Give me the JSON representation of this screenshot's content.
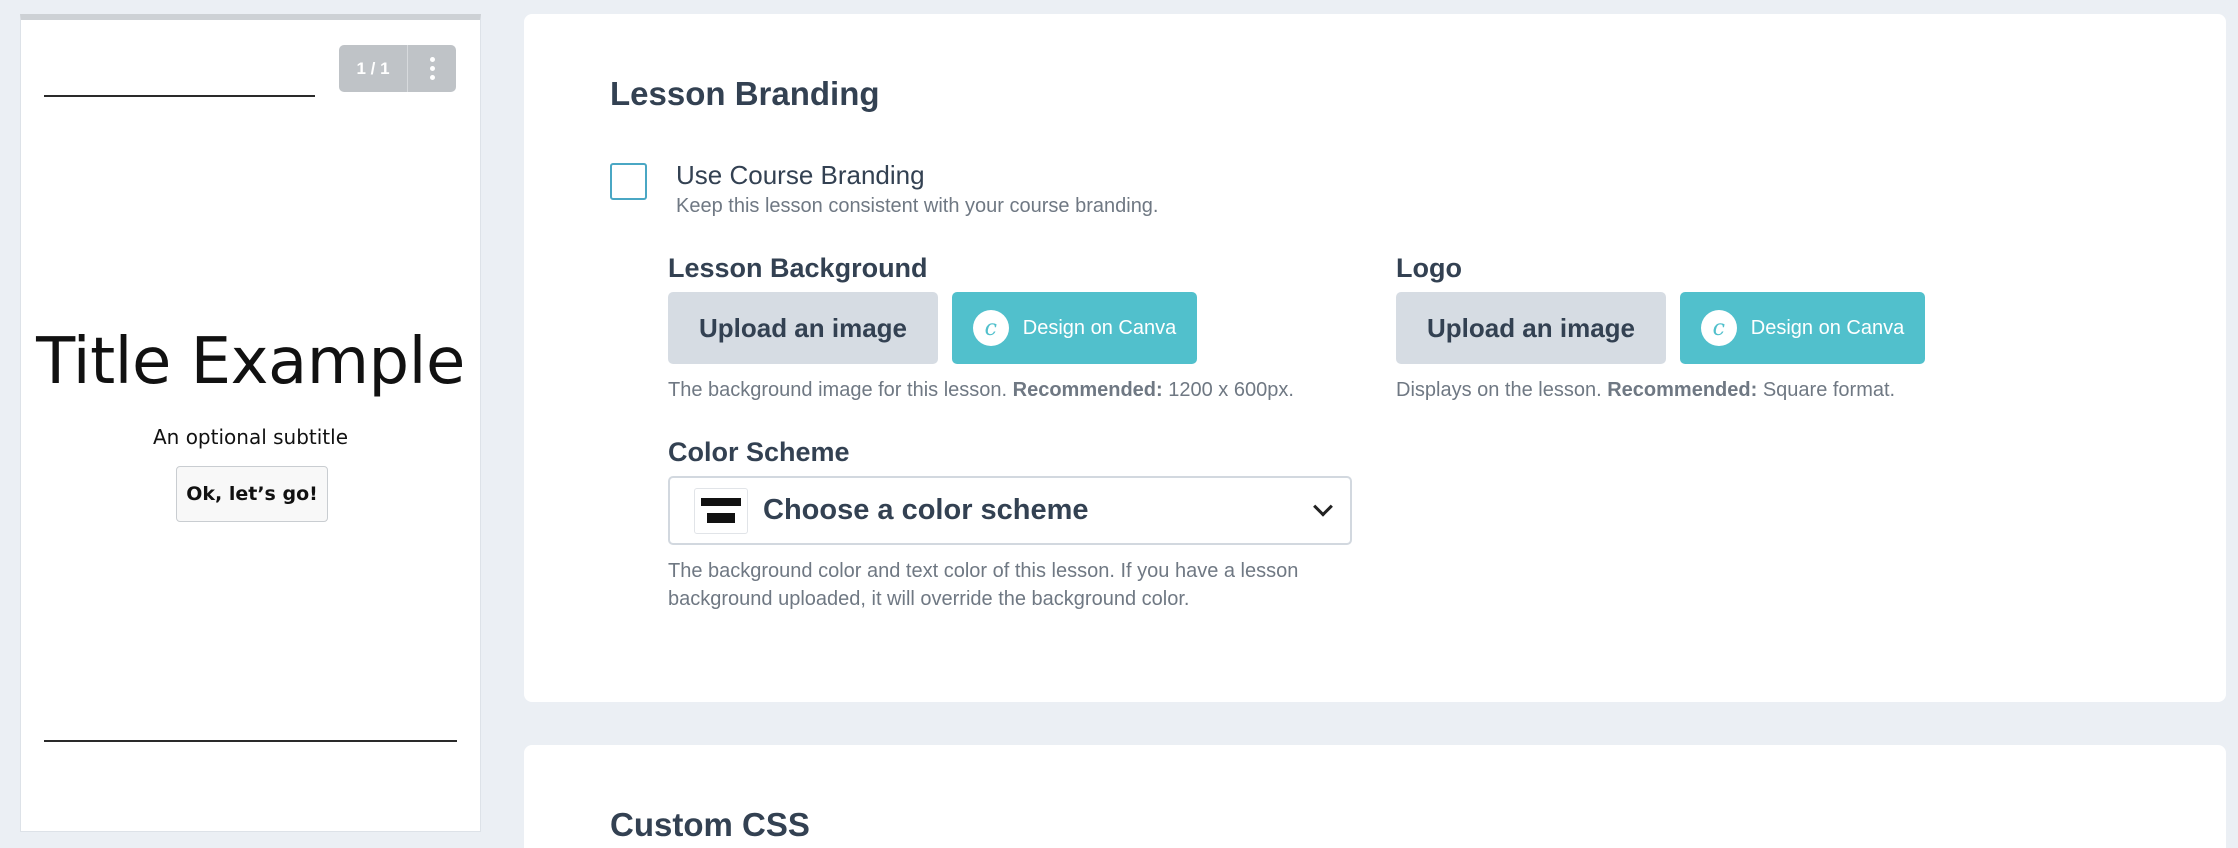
{
  "preview": {
    "pager_count": "1 / 1",
    "title": "Title Example",
    "subtitle": "An optional subtitle",
    "cta_label": "Ok, let’s go!"
  },
  "branding": {
    "heading": "Lesson Branding",
    "use_course_branding": {
      "label": "Use Course Branding",
      "help": "Keep this lesson consistent with your course branding.",
      "checked": false
    },
    "background": {
      "label": "Lesson Background",
      "upload_label": "Upload an image",
      "canva_label": "Design on Canva",
      "help_prefix": "The background image for this lesson.",
      "help_bold": "Recommended:",
      "help_suffix": "1200 x 600px."
    },
    "logo": {
      "label": "Logo",
      "upload_label": "Upload an image",
      "canva_label": "Design on Canva",
      "help_prefix": "Displays on the lesson.",
      "help_bold": "Recommended:",
      "help_suffix": "Square format."
    },
    "color_scheme": {
      "label": "Color Scheme",
      "value": "Choose a color scheme",
      "help_line1": "The background color and text color of this lesson. If you have a lesson",
      "help_line2": "background uploaded, it will override the background color."
    }
  },
  "custom_css": {
    "heading": "Custom CSS"
  },
  "colors": {
    "page_bg": "#ebeff4",
    "accent": "#51c0cc",
    "checkbox_border": "#4aa7c4",
    "text": "#334152"
  },
  "icons": {
    "canva": "canva-icon",
    "menu": "kebab-menu-icon",
    "dropdown": "chevron-down-icon",
    "swatch": "color-swatch-icon"
  }
}
